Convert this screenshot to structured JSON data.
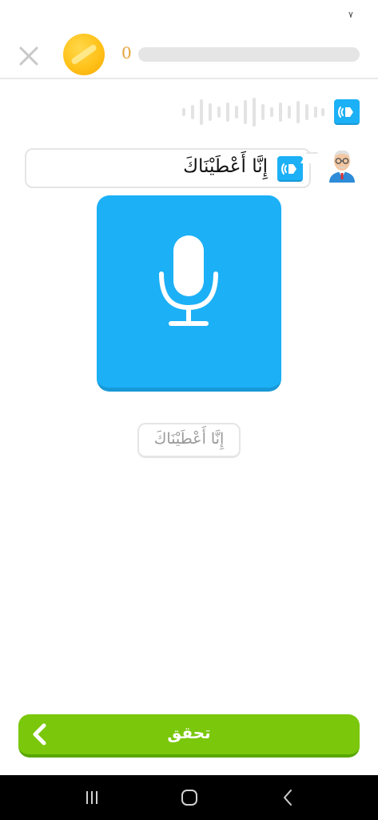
{
  "status_bar": {
    "glyph": "٧"
  },
  "top_bar": {
    "close_icon": "close-icon",
    "coin_icon": "coin-icon",
    "xp_count": "0",
    "progress": 0.0
  },
  "prompt": {
    "waveform_icon": "waveform-icon",
    "speaker_icon": "speaker-icon"
  },
  "bubble": {
    "text": "إِنَّا أَعْطَيْنَاكَ",
    "speaker_icon": "speaker-icon",
    "avatar_icon": "teacher-avatar-icon"
  },
  "mic": {
    "icon": "microphone-icon"
  },
  "phrase_chip": {
    "text": "إِنَّا أَعْطَيْنَاكَ"
  },
  "check_button": {
    "label": "تحقق",
    "icon": "chevron-left-icon"
  },
  "nav_bar": {
    "items": [
      "recents-icon",
      "home-icon",
      "back-icon"
    ]
  },
  "colors": {
    "accent_blue": "#1cb0f6",
    "button_green": "#7ac70c",
    "coin_gold": "#ffc21a",
    "xp_text": "#e5a33a",
    "track_gray": "#e5e5e5"
  }
}
